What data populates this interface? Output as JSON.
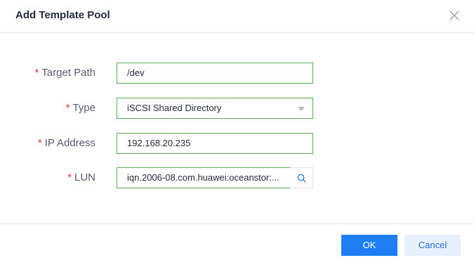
{
  "dialog": {
    "title": "Add Template Pool"
  },
  "form": {
    "required_mark": "*",
    "target_path": {
      "label": "Target Path",
      "value": "/dev"
    },
    "type": {
      "label": "Type",
      "value": "iSCSI Shared Directory"
    },
    "ip_address": {
      "label": "IP Address",
      "value": "192.168.20.235"
    },
    "lun": {
      "label": "LUN",
      "value": "iqn.2006-08.com.huawei:oceanstor:..."
    }
  },
  "footer": {
    "ok_label": "OK",
    "cancel_label": "Cancel"
  },
  "colors": {
    "primary": "#1f7ef2",
    "secondary_bg": "#e6f0fd",
    "valid_border": "#52b152",
    "required": "#e0383e"
  },
  "icons": {
    "close": "close-icon",
    "dropdown": "chevron-down-icon",
    "search": "search-icon"
  }
}
